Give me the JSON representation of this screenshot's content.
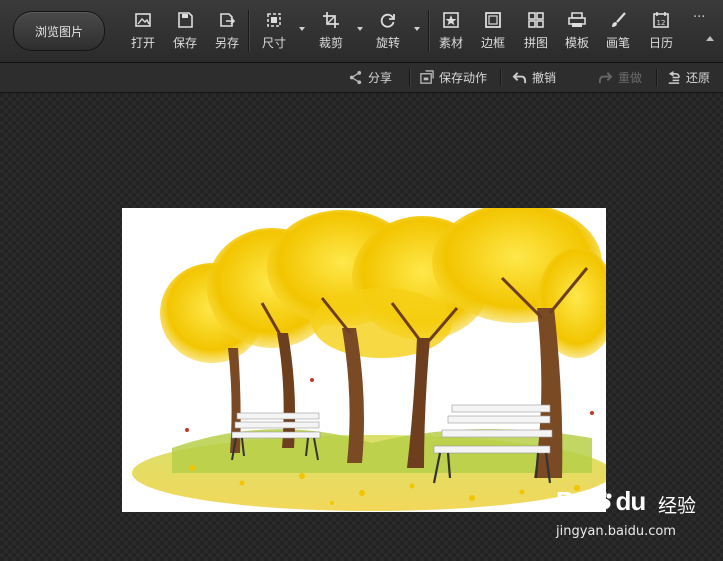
{
  "toolbar": {
    "browse_label": "浏览图片",
    "tools": [
      {
        "label": "打开",
        "icon": "open-icon"
      },
      {
        "label": "保存",
        "icon": "save-icon"
      },
      {
        "label": "另存",
        "icon": "save-as-icon"
      },
      {
        "label": "尺寸",
        "icon": "resize-icon"
      },
      {
        "label": "裁剪",
        "icon": "crop-icon"
      },
      {
        "label": "旋转",
        "icon": "rotate-icon"
      },
      {
        "label": "素材",
        "icon": "sticker-icon"
      },
      {
        "label": "边框",
        "icon": "frame-icon"
      },
      {
        "label": "拼图",
        "icon": "collage-icon"
      },
      {
        "label": "模板",
        "icon": "template-icon"
      },
      {
        "label": "画笔",
        "icon": "brush-icon"
      },
      {
        "label": "日历",
        "icon": "calendar-icon"
      }
    ],
    "more_label": "···"
  },
  "subbar": {
    "share": "分享",
    "save_action": "保存动作",
    "undo": "撤销",
    "redo": "重做",
    "restore": "还原"
  },
  "watermark": {
    "brand": "Bai",
    "brand_suffix": "du",
    "cn": "经验",
    "url": "jingyan.baidu.com"
  },
  "colors": {
    "toolbar_bg": "#333333",
    "canvas_bg": "#262626",
    "foliage": "#f2c500",
    "trunk": "#7a4a24"
  }
}
